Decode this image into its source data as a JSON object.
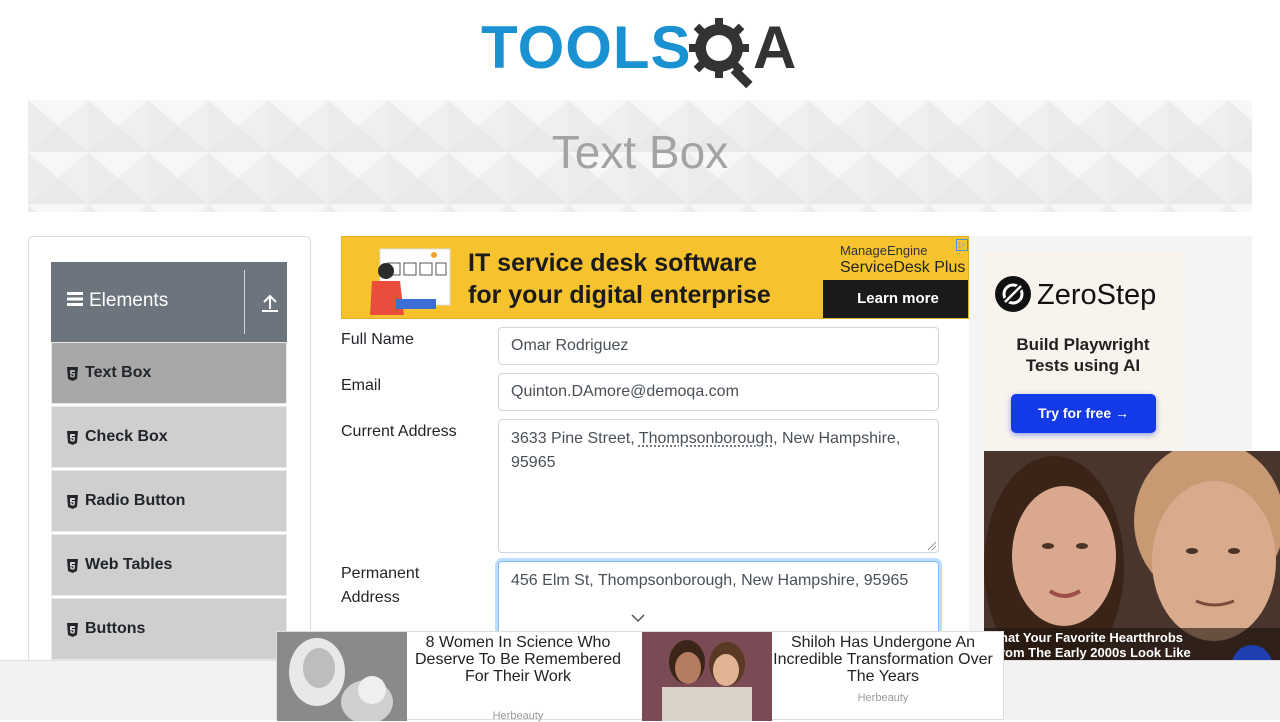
{
  "brand": {
    "logo_text": "TOOLS",
    "logo_suffix": "A"
  },
  "banner": {
    "title": "Text Box"
  },
  "sidebar": {
    "group_title": "Elements",
    "items": [
      {
        "label": "Text Box",
        "active": true
      },
      {
        "label": "Check Box"
      },
      {
        "label": "Radio Button"
      },
      {
        "label": "Web Tables"
      },
      {
        "label": "Buttons"
      }
    ]
  },
  "ad_top": {
    "headline_line1": "IT service desk software",
    "headline_line2": "for your digital enterprise",
    "brand_line1": "ManageEngine",
    "brand_line2": "ServiceDesk Plus",
    "cta": "Learn more"
  },
  "form": {
    "full_name": {
      "label": "Full Name",
      "value": "Omar Rodriguez"
    },
    "email": {
      "label": "Email",
      "value": "Quinton.DAmore@demoqa.com"
    },
    "current_address": {
      "label": "Current Address",
      "value_part1": "3633 Pine Street, ",
      "value_highlight": "Thompsonborough",
      "value_part2": ", New Hampshire, 95965"
    },
    "permanent_address": {
      "label_line1": "Permanent",
      "label_line2": "Address",
      "value": "456 Elm St, Thompsonborough, New Hampshire, 95965"
    }
  },
  "ad_right": {
    "brand": "ZeroStep",
    "tagline_line1": "Build Playwright",
    "tagline_line2": "Tests using AI",
    "cta": "Try for free →",
    "story_caption_line1": "hat Your Favorite Heartthrobs",
    "story_caption_line2": "rom The Early 2000s Look Like"
  },
  "bottom_ad": {
    "story1": "8 Women In Science Who Deserve To Be Remembered For Their Work",
    "story1_source": "Herbeauty",
    "story2": "Shiloh Has Undergone An Incredible Transformation Over The Years",
    "story2_source": "Herbeauty"
  },
  "colors": {
    "accent": "#1a91d0",
    "sidebar_header": "#6c757d",
    "focus": "#80bdff"
  }
}
